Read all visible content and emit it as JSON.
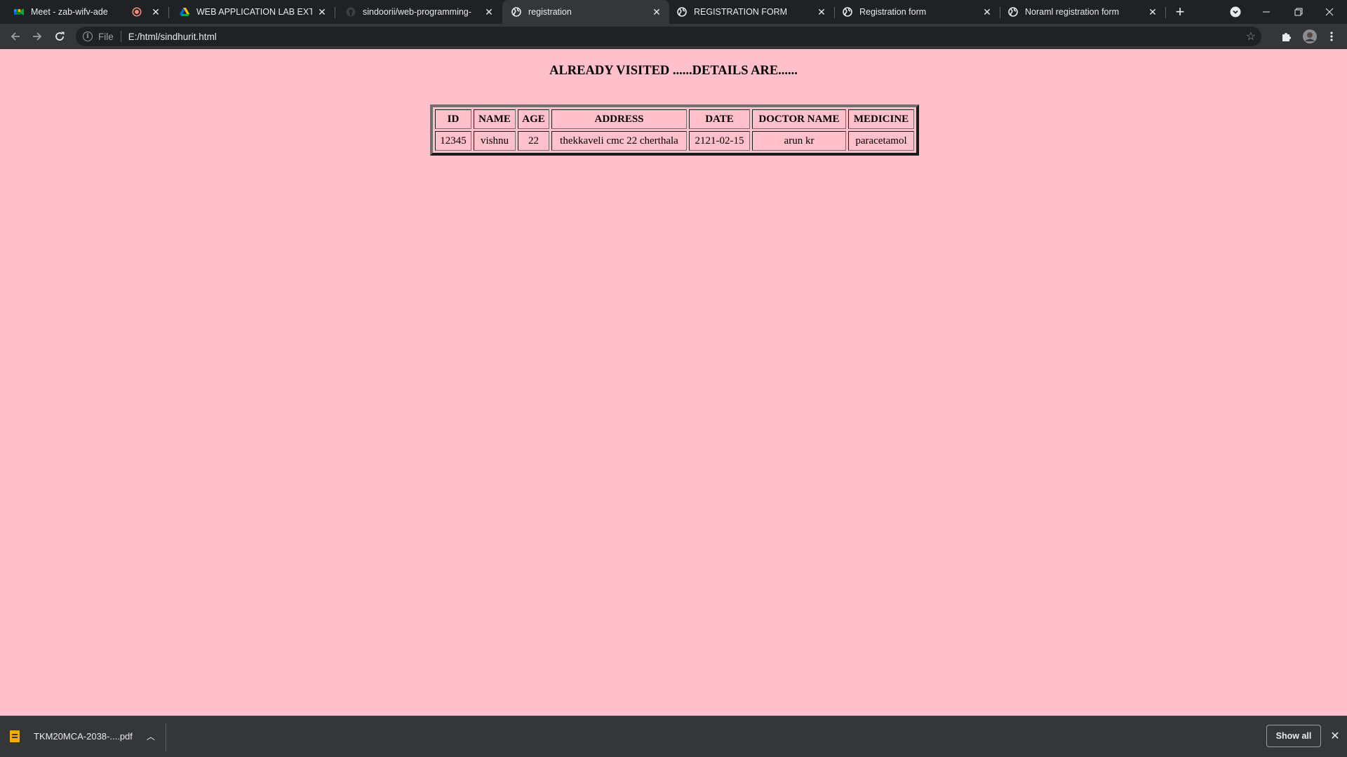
{
  "browser": {
    "tabs": [
      {
        "title": "Meet - zab-wifv-ade",
        "icon": "google-meet-icon",
        "recording": true,
        "active": false
      },
      {
        "title": "WEB APPLICATION LAB EXTERN",
        "icon": "google-drive-icon",
        "active": false
      },
      {
        "title": "sindoorii/web-programming-",
        "icon": "github-icon",
        "active": false
      },
      {
        "title": "registration",
        "icon": "globe-icon",
        "active": true
      },
      {
        "title": "REGISTRATION FORM",
        "icon": "globe-icon",
        "active": false
      },
      {
        "title": "Registration form",
        "icon": "globe-icon",
        "active": false
      },
      {
        "title": "Noraml registration form",
        "icon": "globe-icon",
        "active": false
      }
    ],
    "close_glyph": "✕",
    "new_tab_glyph": "+",
    "address": {
      "scheme_label": "File",
      "url": "E:/html/sindhurit.html"
    }
  },
  "page": {
    "heading": "ALREADY VISITED ......DETAILS ARE......",
    "table": {
      "headers": [
        "ID",
        "NAME",
        "AGE",
        "ADDRESS",
        "DATE",
        "DOCTOR NAME",
        "MEDICINE"
      ],
      "rows": [
        [
          "12345",
          "vishnu",
          "22",
          "thekkaveli cmc 22 cherthala",
          "2121-02-15",
          "arun kr",
          "paracetamol"
        ]
      ]
    }
  },
  "downloads": {
    "file_name": "TKM20MCA-2038-....pdf",
    "file_icon": "pdf-file-icon",
    "show_all_label": "Show all"
  },
  "colors": {
    "page_background": "#ffc0cb",
    "chrome_dark": "#202124",
    "chrome_toolbar": "#35363a"
  }
}
